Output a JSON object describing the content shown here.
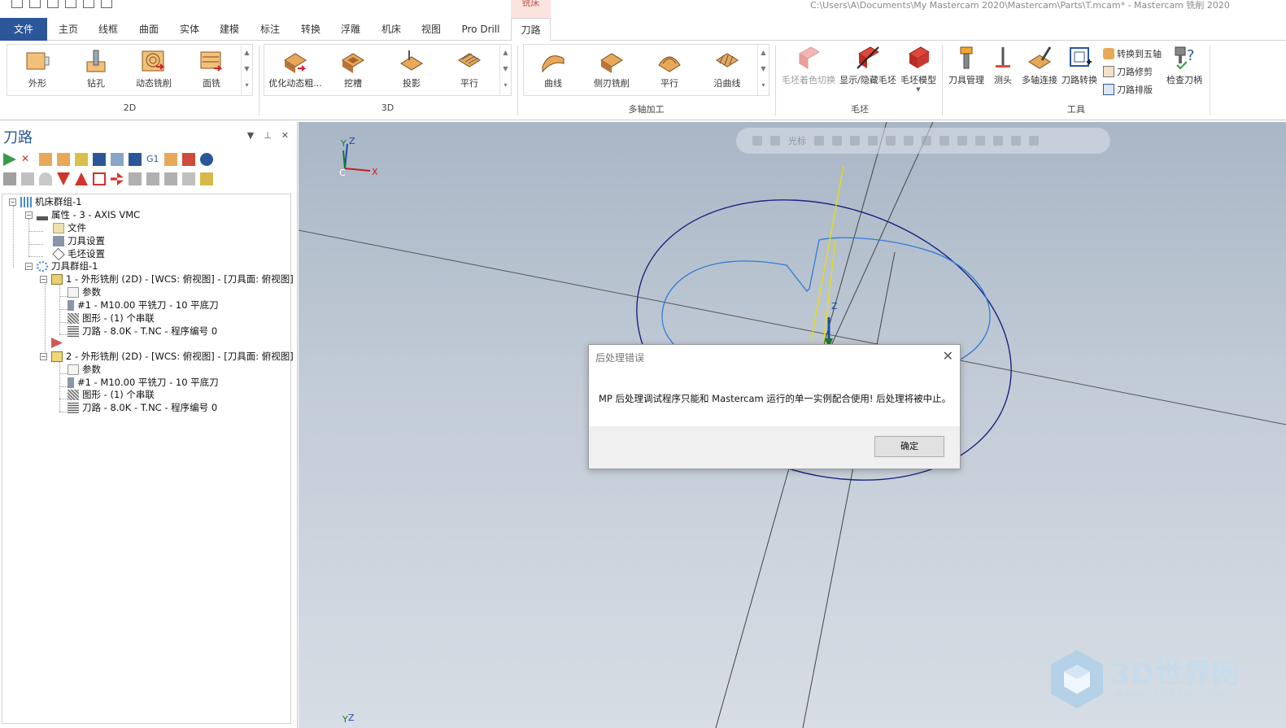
{
  "title_bar": {
    "context_tab": "铣床",
    "path": "C:\\Users\\A\\Documents\\My Mastercam 2020\\Mastercam\\Parts\\T.mcam* - Mastercam 铣削 2020"
  },
  "tabs": [
    "文件",
    "主页",
    "线框",
    "曲面",
    "实体",
    "建模",
    "标注",
    "转换",
    "浮雕",
    "机床",
    "视图",
    "Pro Drill",
    "刀路"
  ],
  "active_tab": "刀路",
  "ribbon": {
    "groups": {
      "g2d": {
        "label": "2D",
        "buttons": [
          "外形",
          "钻孔",
          "动态铣削",
          "面铣"
        ]
      },
      "g3d": {
        "label": "3D",
        "buttons": [
          "优化动态粗...",
          "挖槽",
          "投影",
          "平行"
        ]
      },
      "gmulti": {
        "label": "多轴加工",
        "buttons": [
          "曲线",
          "侧刃铣削",
          "平行",
          "沿曲线"
        ]
      },
      "gstock": {
        "label": "毛坯",
        "buttons": [
          "毛坯着色切换",
          "显示/隐藏毛坯",
          "毛坯模型"
        ]
      },
      "gtools": {
        "label": "工具",
        "buttons": [
          "刀具管理",
          "测头",
          "多轴连接",
          "刀路转换"
        ],
        "small": [
          "转换到五轴",
          "刀路修剪",
          "刀路排版"
        ],
        "check": "检查刀柄"
      }
    }
  },
  "panel": {
    "title": "刀路",
    "tree": {
      "machine_group": "机床群组-1",
      "properties": "属性 - 3 - AXIS VMC",
      "files": "文件",
      "tool_settings": "刀具设置",
      "stock_settings": "毛坯设置",
      "toolpath_group": "刀具群组-1",
      "op1": {
        "title": "1 - 外形铣削 (2D) - [WCS: 俯视图] - [刀具面: 俯视图]",
        "params": "参数",
        "tool": "#1 - M10.00 平铣刀 - 10 平底刀",
        "geometry": "图形 - (1) 个串联",
        "toolpath": "刀路 - 8.0K - T.NC - 程序编号 0"
      },
      "op2": {
        "title": "2 - 外形铣削 (2D) - [WCS: 俯视图] - [刀具面: 俯视图]",
        "params": "参数",
        "tool": "#1 - M10.00 平铣刀 - 10 平底刀",
        "geometry": "图形 - (1) 个串联",
        "toolpath": "刀路 - 8.0K - T.NC - 程序编号 0"
      }
    }
  },
  "viewport": {
    "toolbar_label": "光标",
    "axis_labels": {
      "y": "Y",
      "z": "Z",
      "x": "X",
      "c": "C"
    }
  },
  "dialog": {
    "title": "后处理错误",
    "message": "MP 后处理调试程序只能和 Mastercam 运行的单一实例配合使用! 后处理将被中止。",
    "ok": "确定",
    "close_icon": "close-icon"
  },
  "watermark": {
    "brand": "3D世界网",
    "url": "WWW.3DSJW.COM"
  },
  "colors": {
    "accent": "#2b579a",
    "contour_outer": "#1a237e",
    "contour_inner": "#2e7bd6",
    "context_tab": "#fbe3e0"
  }
}
